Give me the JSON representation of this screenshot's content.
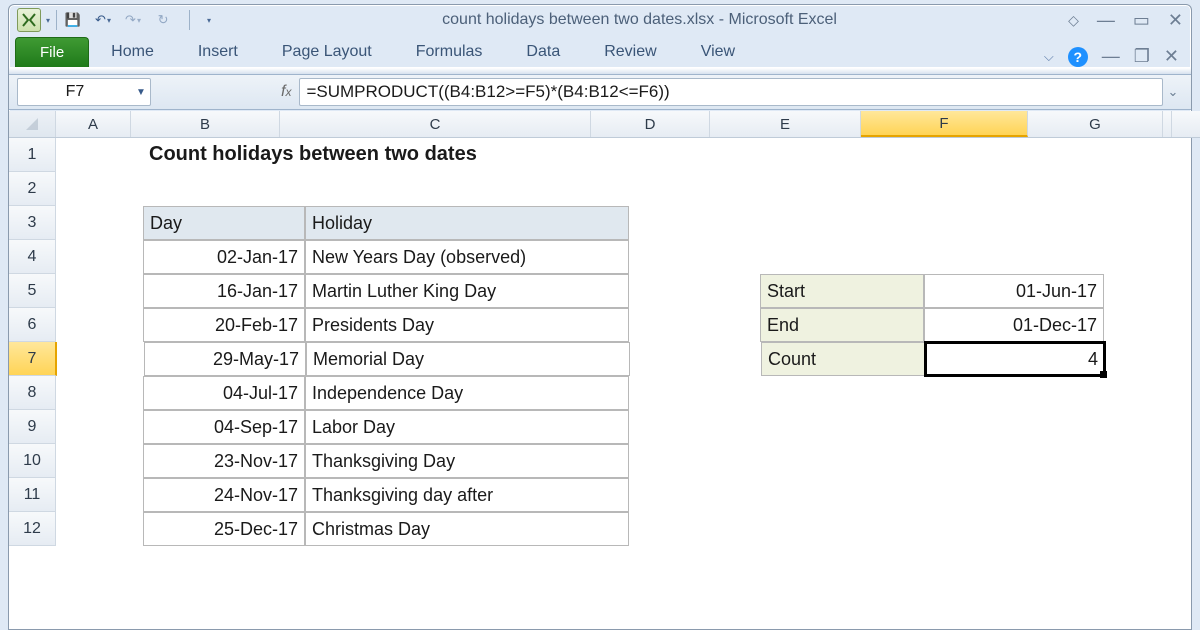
{
  "title": "count holidays between two dates.xlsx - Microsoft Excel",
  "icons": {
    "save": "💾",
    "undo": "↶",
    "redo": "↷"
  },
  "ribbon": {
    "file": "File",
    "tabs": [
      "Home",
      "Insert",
      "Page Layout",
      "Formulas",
      "Data",
      "Review",
      "View"
    ]
  },
  "namebox": "F7",
  "formula": "=SUMPRODUCT((B4:B12>=F5)*(B4:B12<=F6))",
  "cols": [
    "A",
    "B",
    "C",
    "D",
    "E",
    "F",
    "G"
  ],
  "rowcount": 12,
  "selected": {
    "row": "7",
    "col": "F"
  },
  "sheet_title": "Count holidays between two dates",
  "headers": {
    "b": "Day",
    "c": "Holiday"
  },
  "holidays": [
    {
      "day": "02-Jan-17",
      "name": "New Years Day (observed)"
    },
    {
      "day": "16-Jan-17",
      "name": "Martin Luther King Day"
    },
    {
      "day": "20-Feb-17",
      "name": "Presidents Day"
    },
    {
      "day": "29-May-17",
      "name": "Memorial Day"
    },
    {
      "day": "04-Jul-17",
      "name": "Independence Day"
    },
    {
      "day": "04-Sep-17",
      "name": "Labor Day"
    },
    {
      "day": "23-Nov-17",
      "name": "Thanksgiving Day"
    },
    {
      "day": "24-Nov-17",
      "name": "Thanksgiving day after"
    },
    {
      "day": "25-Dec-17",
      "name": "Christmas Day"
    }
  ],
  "side": {
    "start_lbl": "Start",
    "start_val": "01-Jun-17",
    "end_lbl": "End",
    "end_val": "01-Dec-17",
    "count_lbl": "Count",
    "count_val": "4"
  },
  "chart_data": {
    "type": "table",
    "title": "Count holidays between two dates",
    "columns": [
      "Day",
      "Holiday"
    ],
    "rows": [
      [
        "02-Jan-17",
        "New Years Day (observed)"
      ],
      [
        "16-Jan-17",
        "Martin Luther King Day"
      ],
      [
        "20-Feb-17",
        "Presidents Day"
      ],
      [
        "29-May-17",
        "Memorial Day"
      ],
      [
        "04-Jul-17",
        "Independence Day"
      ],
      [
        "04-Sep-17",
        "Labor Day"
      ],
      [
        "23-Nov-17",
        "Thanksgiving Day"
      ],
      [
        "24-Nov-17",
        "Thanksgiving day after"
      ],
      [
        "25-Dec-17",
        "Christmas Day"
      ]
    ],
    "parameters": {
      "Start": "01-Jun-17",
      "End": "01-Dec-17",
      "Count": 4
    },
    "formula": "=SUMPRODUCT((B4:B12>=F5)*(B4:B12<=F6))"
  }
}
